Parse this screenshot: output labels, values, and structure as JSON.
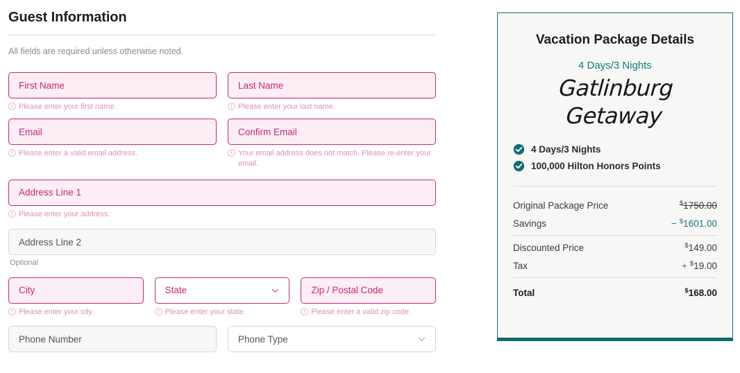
{
  "form": {
    "title": "Guest Information",
    "note": "All fields are required unless otherwise noted.",
    "fields": {
      "first_name": {
        "placeholder": "First Name",
        "error": "Please enter your first name."
      },
      "last_name": {
        "placeholder": "Last Name",
        "error": "Please enter your last name."
      },
      "email": {
        "placeholder": "Email",
        "error": "Please enter a valid email address."
      },
      "confirm_email": {
        "placeholder": "Confirm Email",
        "error": "Your email address does not match. Please re-enter your email."
      },
      "address1": {
        "placeholder": "Address Line 1",
        "error": "Please enter your address."
      },
      "address2": {
        "placeholder": "Address Line 2",
        "helper": "Optional"
      },
      "city": {
        "placeholder": "City",
        "error": "Please enter your city."
      },
      "state": {
        "placeholder": "State",
        "error": "Please enter your state."
      },
      "zip": {
        "placeholder": "Zip / Postal Code",
        "error": "Please enter a valid zip code."
      },
      "phone_number": {
        "placeholder": "Phone Number"
      },
      "phone_type": {
        "placeholder": "Phone Type"
      }
    }
  },
  "package": {
    "title": "Vacation Package Details",
    "duration": "4 Days/3 Nights",
    "name": "Gatlinburg Getaway",
    "features": [
      {
        "label": "4 Days/3 Nights"
      },
      {
        "label": "100,000 Hilton Honors Points"
      }
    ],
    "pricing": [
      {
        "label": "Original Package Price",
        "operator": "",
        "currency": "$",
        "amount": "1750.00"
      },
      {
        "label": "Savings",
        "operator": "−",
        "currency": "$",
        "amount": "1601.00"
      },
      {
        "label": "Discounted Price",
        "operator": "",
        "currency": "$",
        "amount": "149.00"
      },
      {
        "label": "Tax",
        "operator": "+",
        "currency": "$",
        "amount": "19.00"
      },
      {
        "label": "Total",
        "operator": "",
        "currency": "$",
        "amount": "168.00"
      }
    ]
  },
  "colors": {
    "error_border": "#c4277a",
    "error_fill": "#fdeef5",
    "error_text": "#e08fb6",
    "teal": "#157a77",
    "panel_border": "#0f6e74"
  }
}
